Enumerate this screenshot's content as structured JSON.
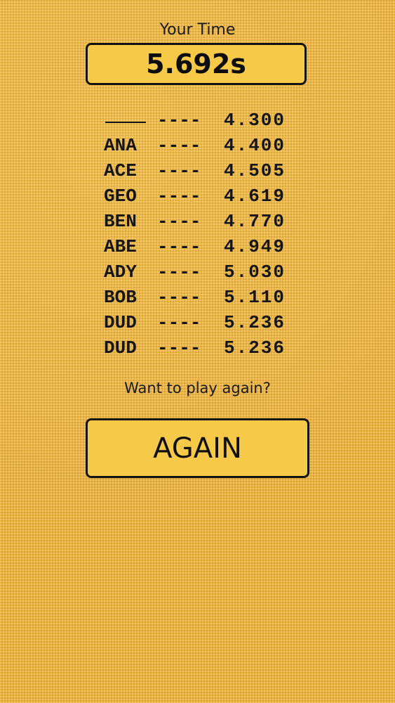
{
  "header": {
    "label": "Your Time",
    "time": "5.692s"
  },
  "scores": [
    {
      "name": "",
      "dash": "----",
      "time": "4.300"
    },
    {
      "name": "ANA",
      "dash": "----",
      "time": "4.400"
    },
    {
      "name": "ACE",
      "dash": "----",
      "time": "4.505"
    },
    {
      "name": "GEO",
      "dash": "----",
      "time": "4.619"
    },
    {
      "name": "BEN",
      "dash": "----",
      "time": "4.770"
    },
    {
      "name": "ABE",
      "dash": "----",
      "time": "4.949"
    },
    {
      "name": "ADY",
      "dash": "----",
      "time": "5.030"
    },
    {
      "name": "BOB",
      "dash": "----",
      "time": "5.110"
    },
    {
      "name": "DUD",
      "dash": "----",
      "time": "5.236"
    },
    {
      "name": "DUD",
      "dash": "----",
      "time": "5.236"
    }
  ],
  "footer": {
    "prompt": "Want to play again?",
    "button_label": "AGAIN"
  },
  "colors": {
    "background": "#f2b53b",
    "box_fill": "#f6ca48",
    "border": "#141414"
  }
}
